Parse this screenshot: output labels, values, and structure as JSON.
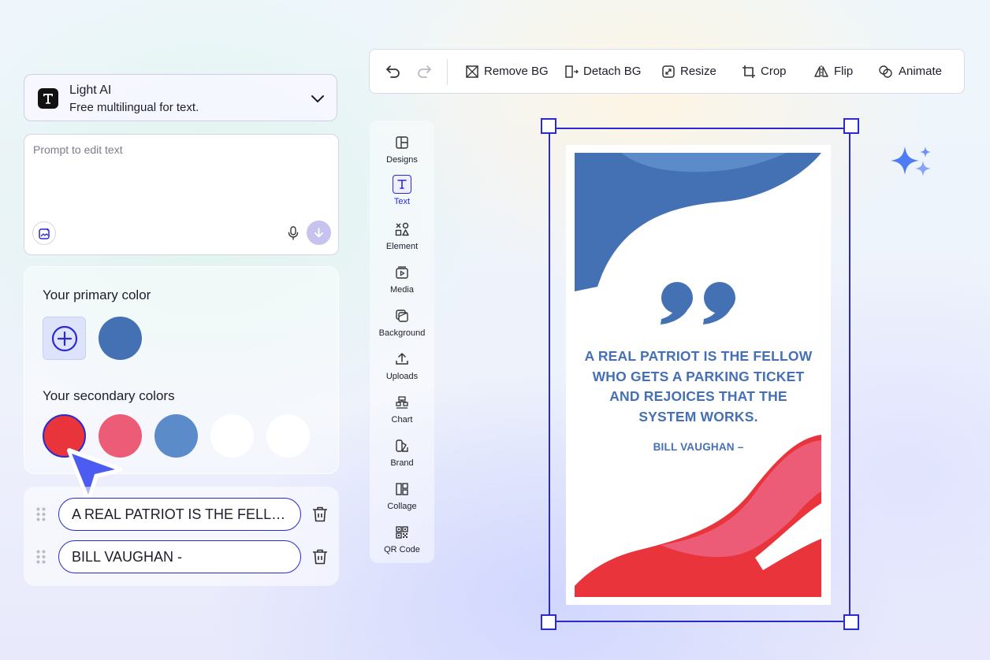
{
  "model": {
    "name": "Light AI",
    "description": "Free multilingual for text."
  },
  "prompt": {
    "placeholder": "Prompt to edit text",
    "value": ""
  },
  "colors": {
    "primary_label": "Your primary color",
    "primary": [
      "#4471b3"
    ],
    "secondary_label": "Your secondary colors",
    "secondary": [
      "#e8343a",
      "#ec5c76",
      "#5b8bc9",
      "#ffffff",
      "#ffffff"
    ],
    "accent": "#2a2ad0"
  },
  "text_items": [
    "A REAL PATRIOT IS THE FELLOW WHO GETS A PARKING TICKET AND REJOICES THAT THE SYSTEM WORKS.",
    "BILL VAUGHAN -"
  ],
  "toolbar": {
    "remove_bg": "Remove BG",
    "detach_bg": "Detach BG",
    "resize": "Resize",
    "crop": "Crop",
    "flip": "Flip",
    "animate": "Animate"
  },
  "rail": [
    {
      "label": "Designs",
      "icon": "layout-icon"
    },
    {
      "label": "Text",
      "icon": "text-icon",
      "active": true
    },
    {
      "label": "Element",
      "icon": "shapes-icon"
    },
    {
      "label": "Media",
      "icon": "media-icon"
    },
    {
      "label": "Background",
      "icon": "background-icon"
    },
    {
      "label": "Uploads",
      "icon": "upload-icon"
    },
    {
      "label": "Chart",
      "icon": "chart-icon"
    },
    {
      "label": "Brand",
      "icon": "brand-icon"
    },
    {
      "label": "Collage",
      "icon": "collage-icon"
    },
    {
      "label": "QR Code",
      "icon": "qr-code-icon"
    }
  ],
  "poster": {
    "quote": "A REAL PATRIOT IS THE FELLOW WHO GETS A PARKING TICKET AND REJOICES THAT THE SYSTEM WORKS.",
    "author": "BILL VAUGHAN –",
    "text_color": "#4670b5"
  }
}
